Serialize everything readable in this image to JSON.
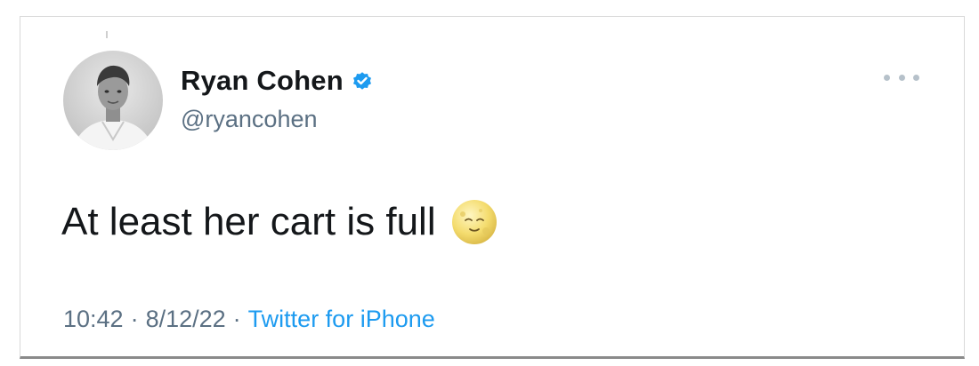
{
  "tweet": {
    "display_name": "Ryan Cohen",
    "handle": "@ryancohen",
    "verified": true,
    "text": "At least her cart is full",
    "emoji": "full-moon-face",
    "time": "10:42",
    "date": "8/12/22",
    "source": "Twitter for iPhone",
    "separator": "·"
  },
  "icons": {
    "verified": "verified-badge-icon",
    "more": "more-options-icon"
  },
  "colors": {
    "name": "#14171a",
    "secondary": "#5b7083",
    "link": "#1d9bf0",
    "verified": "#1d9bf0"
  }
}
